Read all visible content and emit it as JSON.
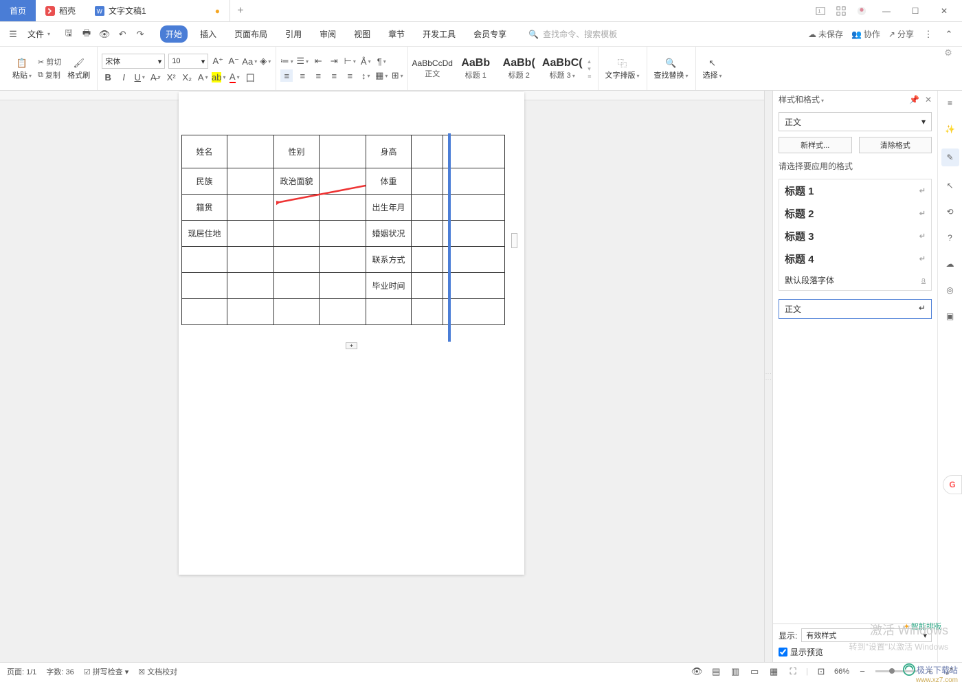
{
  "tabs": {
    "home": "首页",
    "dao": "稻壳",
    "doc": "文字文稿1"
  },
  "menu": {
    "file": "文件",
    "items": [
      "开始",
      "插入",
      "页面布局",
      "引用",
      "审阅",
      "视图",
      "章节",
      "开发工具",
      "会员专享"
    ],
    "search": "查找命令、搜索模板",
    "unsaved": "未保存",
    "collab": "协作",
    "share": "分享"
  },
  "ribbon": {
    "paste": "粘贴",
    "cut": "剪切",
    "copy": "复制",
    "format_painter": "格式刷",
    "font_name": "宋体",
    "font_size": "10",
    "styles": [
      {
        "preview": "AaBbCcDd",
        "label": "正文"
      },
      {
        "preview": "AaBb",
        "label": "标题 1"
      },
      {
        "preview": "AaBb(",
        "label": "标题 2"
      },
      {
        "preview": "AaBbC(",
        "label": "标题 3"
      }
    ],
    "text_layout": "文字排版",
    "find_replace": "查找替换",
    "select": "选择"
  },
  "panel": {
    "title": "样式和格式",
    "current": "正文",
    "new_style": "新样式...",
    "clear": "清除格式",
    "choose": "请选择要应用的格式",
    "items": [
      "标题 1",
      "标题 2",
      "标题 3",
      "标题 4",
      "默认段落字体"
    ],
    "applied": "正文",
    "show_label": "显示:",
    "show_value": "有效样式",
    "preview": "显示预览"
  },
  "table": {
    "r1": [
      "姓名",
      "",
      "性别",
      "",
      "身高",
      "",
      ""
    ],
    "r2": [
      "民族",
      "",
      "政治面貌",
      "",
      "体重",
      "",
      ""
    ],
    "r3": [
      "籍贯",
      "",
      "",
      "",
      "出生年月",
      "",
      ""
    ],
    "r4": [
      "现居住地",
      "",
      "",
      "",
      "婚姻状况",
      "",
      ""
    ],
    "r5": [
      "",
      "",
      "",
      "",
      "联系方式",
      "",
      ""
    ],
    "r6": [
      "",
      "",
      "",
      "",
      "毕业时间",
      "",
      ""
    ],
    "r7": [
      "",
      "",
      "",
      "",
      "",
      "",
      ""
    ]
  },
  "status": {
    "page": "页面: 1/1",
    "words": "字数: 36",
    "spell": "拼写检查",
    "proof": "文档校对",
    "zoom": "66%"
  },
  "watermark": {
    "l1": "激活 Windows",
    "l2": "转到\"设置\"以激活 Windows",
    "brand": "极光下载站",
    "url": "www.xz7.com"
  },
  "smart_layout": "智能排版"
}
